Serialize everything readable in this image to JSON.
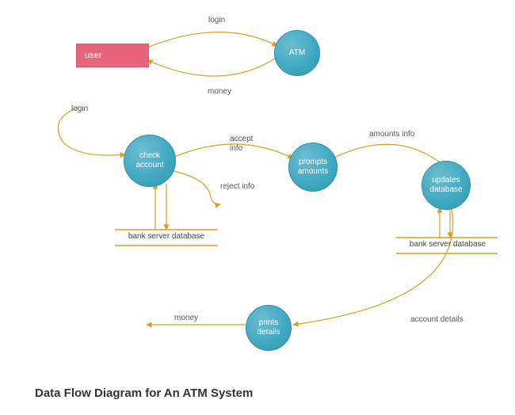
{
  "title": "Data Flow Diagram for An ATM System",
  "entities": {
    "user": "user"
  },
  "processes": {
    "atm": "ATM",
    "check_account": "check\naccount",
    "prompts_amounts": "prompts\namounts",
    "updates_database": "updates\ndatabase",
    "prints_details": "prints\ndetails"
  },
  "datastores": {
    "db1": "bank server database",
    "db2": "bank server database"
  },
  "edges": {
    "login_top": "login",
    "money_top": "money",
    "login_left": "login",
    "accept_info": "accept\ninfo",
    "reject_info": "reject info",
    "amounts_info": "amounts info",
    "account_details": "account details",
    "money_bottom": "money"
  },
  "colors": {
    "entity": "#e8647a",
    "process": "#3fa8c1",
    "edge": "#d5a020",
    "datastore_border": "#c89a1e"
  }
}
